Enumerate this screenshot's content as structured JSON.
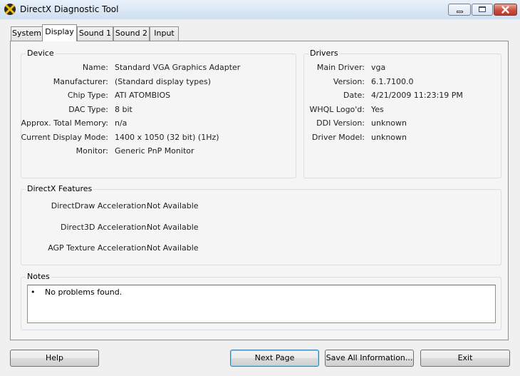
{
  "window": {
    "title": "DirectX Diagnostic Tool"
  },
  "tabs": [
    "System",
    "Display",
    "Sound 1",
    "Sound 2",
    "Input"
  ],
  "device": {
    "title": "Device",
    "rows": [
      {
        "label": "Name:",
        "value": "Standard VGA Graphics Adapter"
      },
      {
        "label": "Manufacturer:",
        "value": "(Standard display types)"
      },
      {
        "label": "Chip Type:",
        "value": "ATI ATOMBIOS"
      },
      {
        "label": "DAC Type:",
        "value": "8 bit"
      },
      {
        "label": "Approx. Total Memory:",
        "value": "n/a"
      },
      {
        "label": "Current Display Mode:",
        "value": "1400 x 1050 (32 bit) (1Hz)"
      },
      {
        "label": "Monitor:",
        "value": "Generic PnP Monitor"
      }
    ]
  },
  "drivers": {
    "title": "Drivers",
    "rows": [
      {
        "label": "Main Driver:",
        "value": "vga"
      },
      {
        "label": "Version:",
        "value": "6.1.7100.0"
      },
      {
        "label": "Date:",
        "value": "4/21/2009 11:23:19 PM"
      },
      {
        "label": "WHQL Logo'd:",
        "value": "Yes"
      },
      {
        "label": "DDI Version:",
        "value": "unknown"
      },
      {
        "label": "Driver Model:",
        "value": "unknown"
      }
    ]
  },
  "features": {
    "title": "DirectX Features",
    "rows": [
      {
        "label": "DirectDraw Acceleration:",
        "value": "Not Available"
      },
      {
        "label": "Direct3D Acceleration:",
        "value": "Not Available"
      },
      {
        "label": "AGP Texture Acceleration:",
        "value": "Not Available"
      }
    ]
  },
  "notes": {
    "title": "Notes",
    "bullet": "•",
    "items": [
      "No problems found."
    ]
  },
  "buttons": {
    "help": "Help",
    "next_page": "Next Page",
    "save_all": "Save All Information...",
    "exit": "Exit"
  },
  "colors": {
    "title_bar": "#dbe8f5",
    "panel": "#f5f5f5",
    "close_button": "#c75040"
  }
}
